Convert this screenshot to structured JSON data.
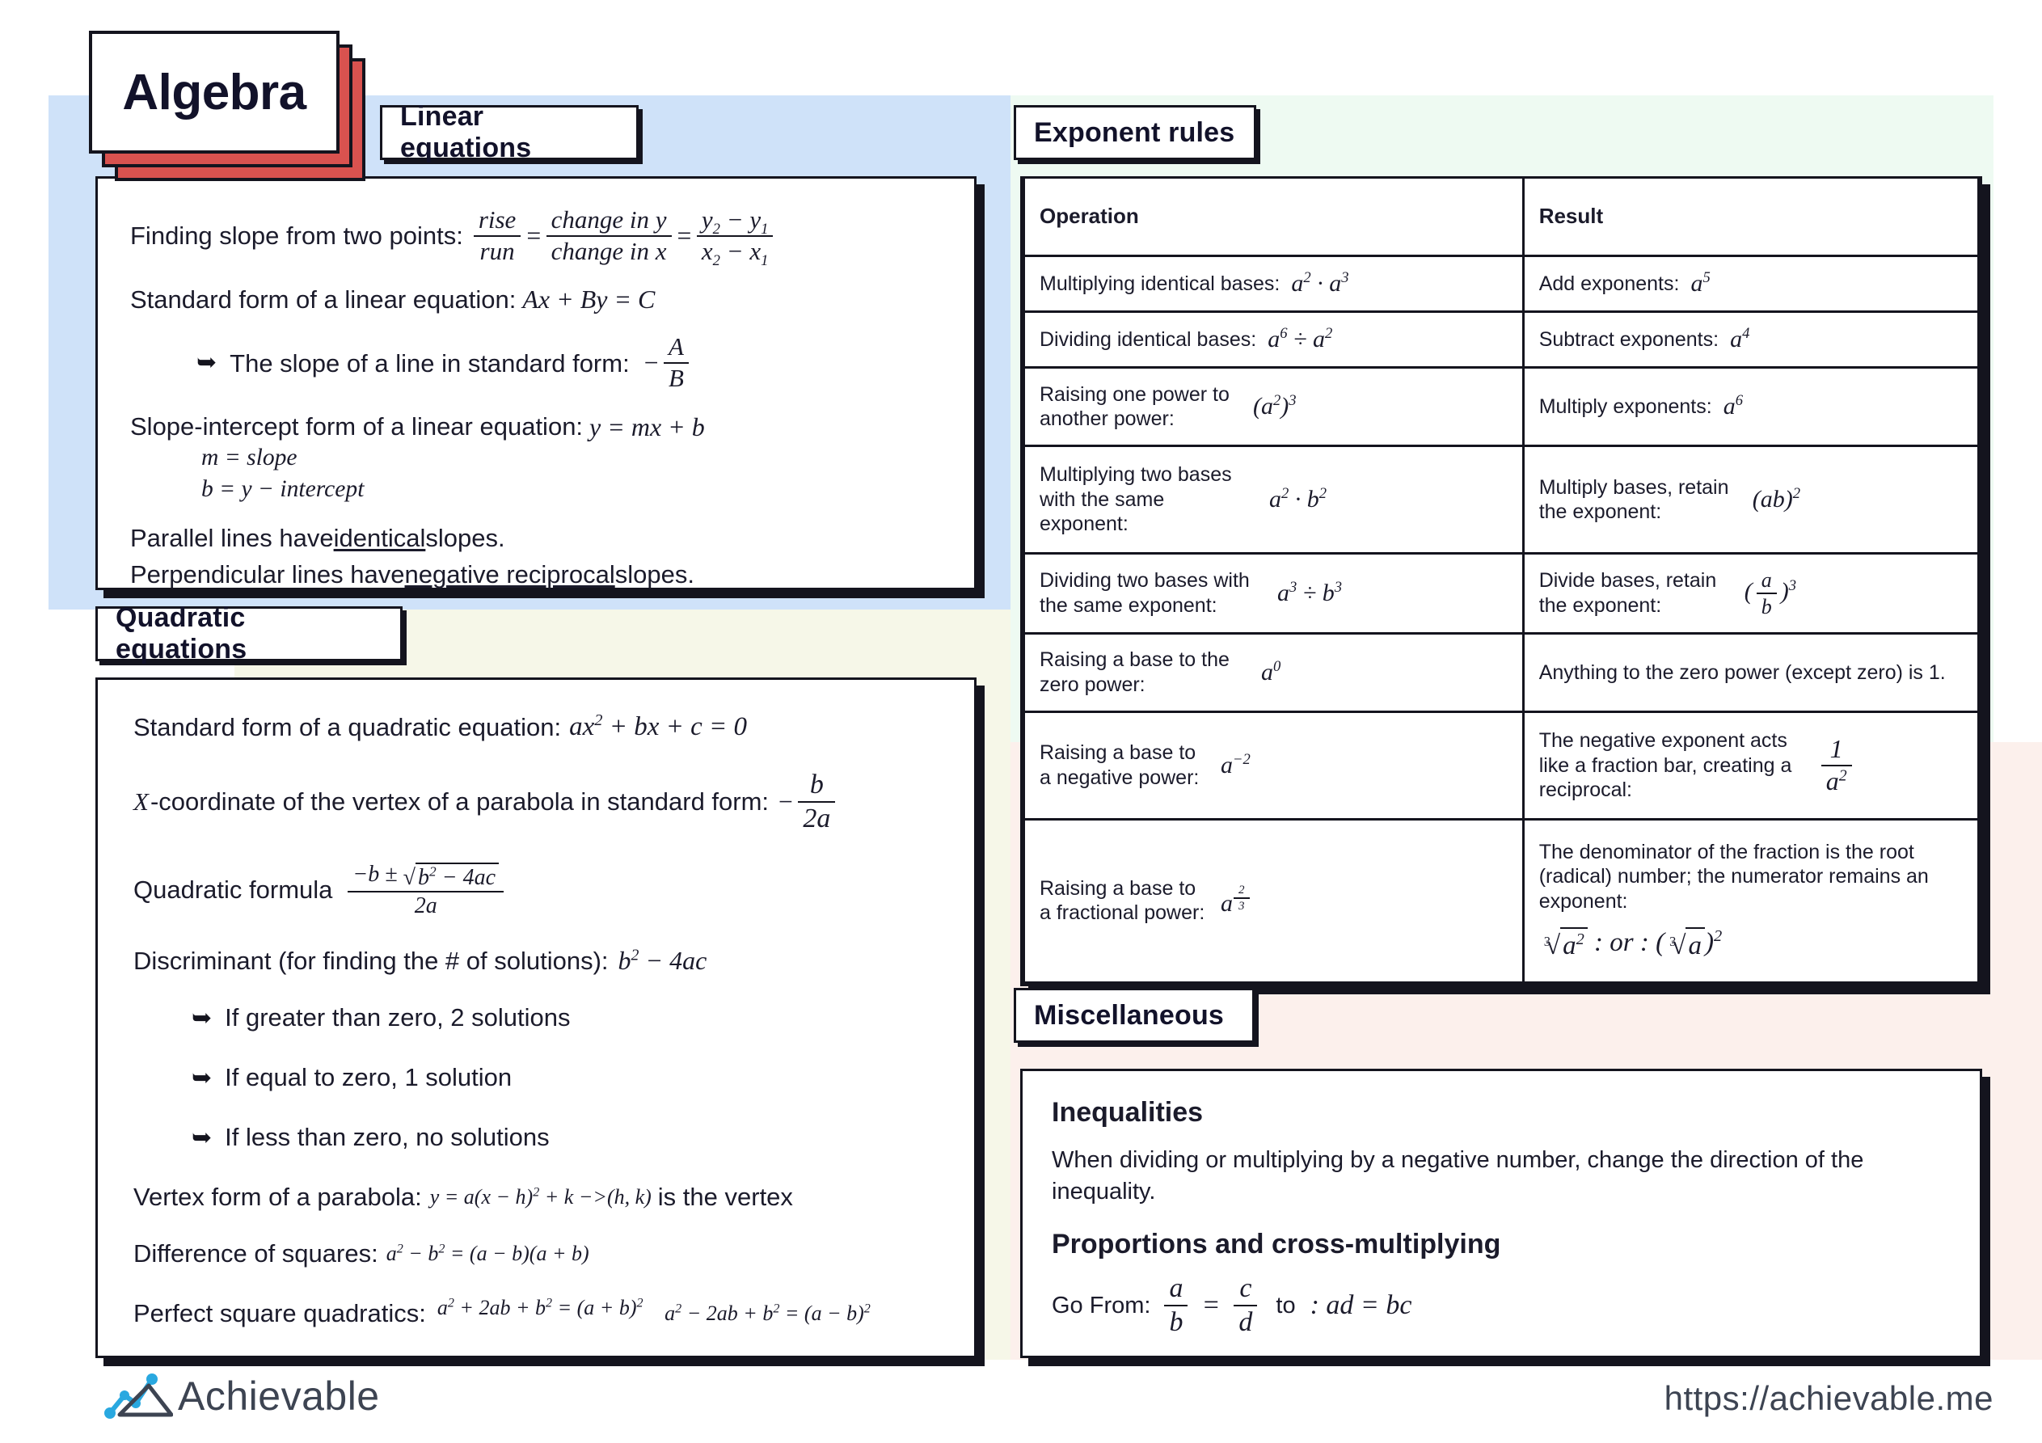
{
  "page": {
    "title": "Algebra",
    "accent_red": "#d9524f",
    "ink": "#14141e",
    "band_blue": "#cfe2f9",
    "band_ivory": "#f6f7e8",
    "band_mint": "#eefaf2",
    "band_pink": "#fcf0ec"
  },
  "sections": {
    "linear": {
      "heading": "Linear equations"
    },
    "quadratic": {
      "heading": "Quadratic equations"
    },
    "exponent": {
      "heading": "Exponent rules"
    },
    "misc": {
      "heading": "Miscellaneous"
    }
  },
  "linear": {
    "slope_label": "Finding slope from two points:",
    "slope_f1_num": "rise",
    "slope_f1_den": "run",
    "eq1": "=",
    "slope_f2_num": "change in y",
    "slope_f2_den": "change in x",
    "eq2": "=",
    "slope_f3_num_y2": "y",
    "slope_f3_num_sub2": "2",
    "slope_f3_minus": "−",
    "slope_f3_num_y1": "y",
    "slope_f3_num_sub1": "1",
    "slope_f3_den_x2": "x",
    "slope_f3_den_sub2": "2",
    "slope_f3_den_x1": "x",
    "slope_f3_den_sub1": "1",
    "standard_label": "Standard form of a linear equation:",
    "standard_formula": "Ax + By = C",
    "bullet_slope_label": "The slope of a line in standard form:",
    "bullet_minus": "−",
    "bullet_num": "A",
    "bullet_den": "B",
    "intercept_label": "Slope-intercept form of a linear equation:",
    "intercept_formula": "y = mx + b",
    "m_line": "m = slope",
    "b_line": "b = y − intercept",
    "parallel_pre": "Parallel lines have ",
    "parallel_em": "identical",
    "parallel_post": " slopes.",
    "perp_pre": "Perpendicular lines have ",
    "perp_em": "negative reciprocal",
    "perp_post": " slopes."
  },
  "quadratic": {
    "standard_label": "Standard form of a quadratic equation:",
    "standard_formula_a": "ax",
    "standard_formula_exp": "2",
    "standard_formula_b": " + bx + c = 0",
    "vertex_label": "X-coordinate of the vertex of a parabola in standard form:",
    "vertex_minus": "−",
    "vertex_num": "b",
    "vertex_den": "2a",
    "qf_label": "Quadratic formula",
    "qf_num_pre": "−b ±",
    "qf_radicand_b": "b",
    "qf_radicand_exp": "2",
    "qf_radicand_rest": " − 4ac",
    "qf_den": "2a",
    "disc_label": "Discriminant (for finding the # of solutions):",
    "disc_b": "b",
    "disc_exp": "2",
    "disc_rest": " − 4ac",
    "bullets": [
      "If greater than zero, 2 solutions",
      "If equal to zero, 1 solution",
      "If less than zero, no solutions"
    ],
    "vertexform_label": "Vertex form of a parabola:",
    "vertexform_a": "y = a(x − h)",
    "vertexform_exp": "2",
    "vertexform_b": " + k −>(h, k)",
    "vertexform_tail": " is the vertex",
    "dos_label": "Difference of squares:",
    "dos_a": "a",
    "dos_a_exp": "2",
    "dos_mid": " − b",
    "dos_b_exp": "2",
    "dos_rest": " = (a − b)(a + b)",
    "psq_label": "Perfect square quadratics:",
    "psq_line1_a": "a",
    "psq_line1_exp1": "2",
    "psq_line1_mid": " + 2ab + b",
    "psq_line1_exp2": "2",
    "psq_line1_eq": " = (a + b)",
    "psq_line1_exp3": "2",
    "psq_line2_a": "a",
    "psq_line2_exp1": "2",
    "psq_line2_mid": " − 2ab + b",
    "psq_line2_exp2": "2",
    "psq_line2_eq": " = (a − b)",
    "psq_line2_exp3": "2"
  },
  "exponent_table": {
    "headers": [
      "Operation",
      "Result"
    ],
    "rows": [
      {
        "op_text": "Multiplying identical bases:",
        "op_math": {
          "base1": "a",
          "exp1": "2",
          "op": " · ",
          "base2": "a",
          "exp2": "3"
        },
        "res_text": "Add exponents:",
        "res_math": {
          "base": "a",
          "exp": "5"
        }
      },
      {
        "op_text": "Dividing identical bases:",
        "op_math": {
          "base1": "a",
          "exp1": "6",
          "op": " ÷ ",
          "base2": "a",
          "exp2": "2"
        },
        "res_text": "Subtract exponents:",
        "res_math": {
          "base": "a",
          "exp": "4"
        }
      },
      {
        "op_text": "Raising one power to another power:",
        "op_math": {
          "inner": "a",
          "inner_exp": "2",
          "outer_exp": "3"
        },
        "res_text": "Multiply exponents:",
        "res_math": {
          "base": "a",
          "exp": "6"
        }
      },
      {
        "op_text": "Multiplying two bases with the same exponent:",
        "op_math": {
          "base1": "a",
          "exp1": "2",
          "op": " · ",
          "base2": "b",
          "exp2": "2"
        },
        "res_text": "Multiply bases, retain the exponent:",
        "res_math": {
          "inner": "ab",
          "outer_exp": "2"
        }
      },
      {
        "op_text": "Dividing two bases with the same exponent:",
        "op_math": {
          "base1": "a",
          "exp1": "3",
          "op": " ÷ ",
          "base2": "b",
          "exp2": "3"
        },
        "res_text": "Divide bases, retain the exponent:",
        "res_math": {
          "frac_num": "a",
          "frac_den": "b",
          "outer_exp": "3"
        }
      },
      {
        "op_text": "Raising a base to the zero power:",
        "op_math": {
          "base": "a",
          "exp": "0"
        },
        "res_text": "Anything to the zero power (except zero) is 1.",
        "res_math": null
      },
      {
        "op_text": "Raising a base to a negative power:",
        "op_math": {
          "base": "a",
          "exp": "−2"
        },
        "res_text": "The negative exponent acts like a fraction bar, creating a reciprocal:",
        "res_math": {
          "frac_num": "1",
          "frac_den_base": "a",
          "frac_den_exp": "2"
        }
      },
      {
        "op_text": "Raising a base to a fractional power:",
        "op_math": {
          "base": "a",
          "frac_exp_num": "2",
          "frac_exp_den": "3"
        },
        "res_text": "The denominator of the fraction is the root (radical) number; the numerator remains an exponent:",
        "res_math": {
          "radical1_index": "3",
          "radical1_radicand": "a",
          "radical1_exp": "2",
          "sep": " : or : ",
          "radical2_index": "3",
          "radical2_radicand": "a",
          "radical2_outer_exp": "2"
        }
      }
    ]
  },
  "misc": {
    "inequalities_heading": "Inequalities",
    "inequalities_text": "When dividing or multiplying by a negative number, change the direction of the inequality.",
    "proportions_heading": "Proportions and cross-multiplying",
    "go_from_label": "Go From:",
    "prop_num1": "a",
    "prop_den1": "b",
    "prop_eq": "=",
    "prop_num2": "c",
    "prop_den2": "d",
    "to_label": "to",
    "prop_result": ": ad = bc"
  },
  "footer": {
    "brand_name": "Achievable",
    "url": "https://achievable.me",
    "logo_accent": "#29a8e0",
    "logo_dark": "#3d4452"
  }
}
